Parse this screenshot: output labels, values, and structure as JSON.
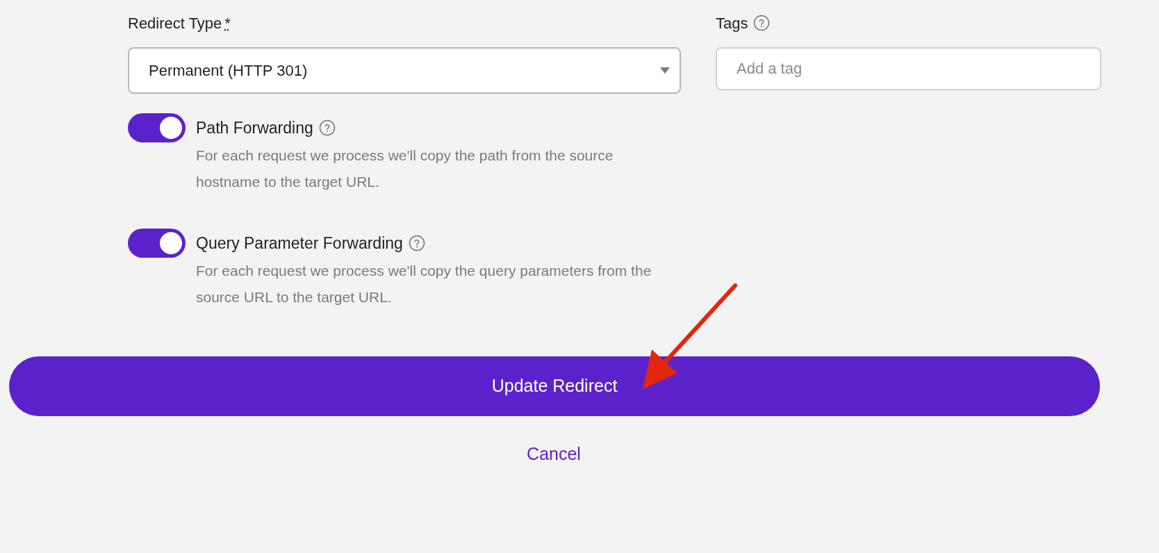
{
  "redirect_type": {
    "label": "Redirect Type",
    "required_marker": "*",
    "value": "Permanent (HTTP 301)"
  },
  "tags": {
    "label": "Tags",
    "placeholder": "Add a tag"
  },
  "toggles": [
    {
      "label": "Path Forwarding",
      "on": true,
      "description": "For each request we process we'll copy the path from the source hostname to the target URL."
    },
    {
      "label": "Query Parameter Forwarding",
      "on": true,
      "description": "For each request we process we'll copy the query parameters from the source URL to the target URL."
    }
  ],
  "primary_button": "Update Redirect",
  "cancel_link": "Cancel"
}
